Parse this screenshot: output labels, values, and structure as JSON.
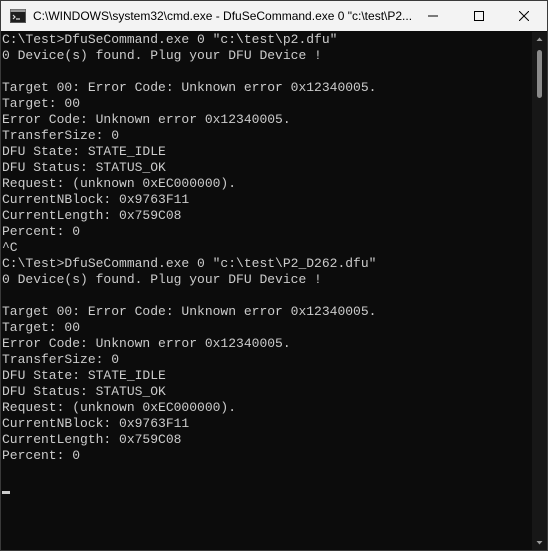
{
  "window": {
    "title": "C:\\WINDOWS\\system32\\cmd.exe - DfuSeCommand.exe  0 \"c:\\test\\P2...",
    "icon": "cmd-icon"
  },
  "controls": {
    "minimize_icon": "minimize-icon",
    "maximize_icon": "maximize-icon",
    "close_icon": "close-icon"
  },
  "console": {
    "lines": [
      "C:\\Test>DfuSeCommand.exe 0 \"c:\\test\\p2.dfu\"",
      "0 Device(s) found. Plug your DFU Device !",
      "",
      "Target 00: Error Code: Unknown error 0x12340005.",
      "Target: 00",
      "Error Code: Unknown error 0x12340005.",
      "TransferSize: 0",
      "DFU State: STATE_IDLE",
      "DFU Status: STATUS_OK",
      "Request: (unknown 0xEC000000).",
      "CurrentNBlock: 0x9763F11",
      "CurrentLength: 0x759C08",
      "Percent: 0",
      "^C",
      "C:\\Test>DfuSeCommand.exe 0 \"c:\\test\\P2_D262.dfu\"",
      "0 Device(s) found. Plug your DFU Device !",
      "",
      "Target 00: Error Code: Unknown error 0x12340005.",
      "Target: 00",
      "Error Code: Unknown error 0x12340005.",
      "TransferSize: 0",
      "DFU State: STATE_IDLE",
      "DFU Status: STATUS_OK",
      "Request: (unknown 0xEC000000).",
      "CurrentNBlock: 0x9763F11",
      "CurrentLength: 0x759C08",
      "Percent: 0",
      ""
    ]
  },
  "colors": {
    "background": "#0c0c0c",
    "text": "#cccccc",
    "titlebar": "#f3f3f3"
  }
}
